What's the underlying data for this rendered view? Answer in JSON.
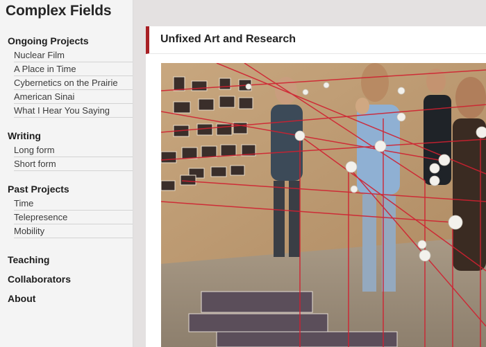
{
  "site": {
    "title": "Complex Fields"
  },
  "nav": {
    "ongoing": {
      "label": "Ongoing Projects",
      "items": [
        "Nuclear Film",
        "A Place in Time",
        "Cybernetics on the Prairie",
        "American Sinai",
        "What I Hear You Saying"
      ]
    },
    "writing": {
      "label": "Writing",
      "items": [
        "Long form",
        "Short form"
      ]
    },
    "past": {
      "label": "Past Projects",
      "items": [
        "Time",
        "Telepresence",
        "Mobility"
      ]
    },
    "teaching": "Teaching",
    "collaborators": "Collaborators",
    "about": "About"
  },
  "main": {
    "title": "Unfixed Art and Research",
    "photo_icon": "installation-photo",
    "accent_color": "#a81f24"
  }
}
